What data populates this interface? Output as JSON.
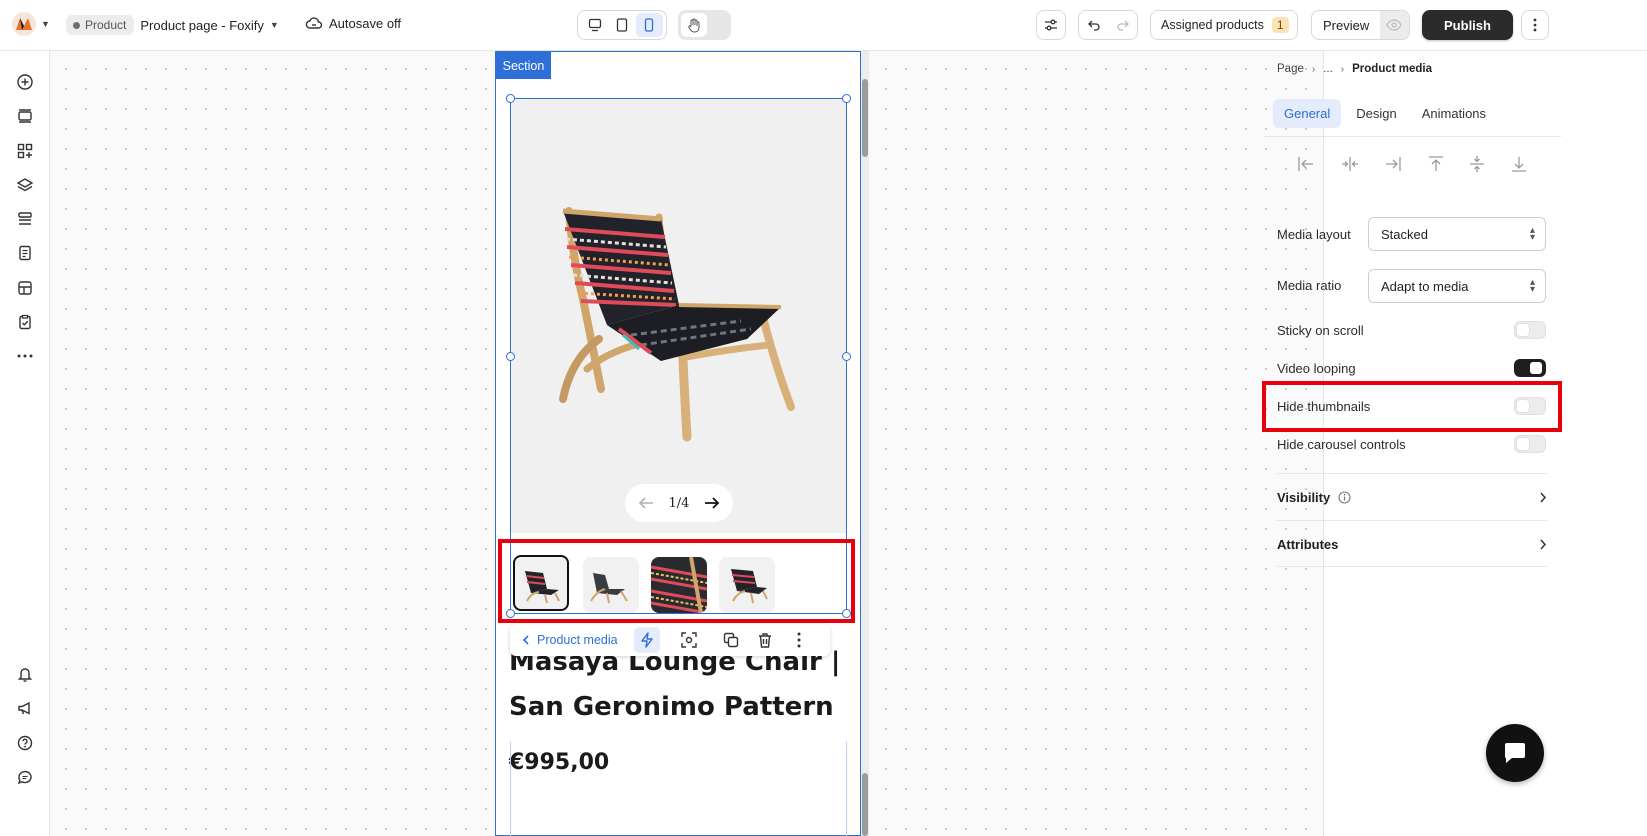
{
  "topbar": {
    "breadcrumb_badge": "Product",
    "page_name": "Product page - Foxify",
    "autosave": "Autosave off",
    "assigned_products": "Assigned products",
    "assigned_count": "1",
    "preview": "Preview",
    "publish": "Publish"
  },
  "leftbar": {
    "icons": [
      "add-icon",
      "section-icon",
      "apps-icon",
      "layers-icon",
      "sections-list-icon",
      "pages-icon",
      "templates-icon",
      "checklist-icon",
      "more-icon",
      "bell-icon",
      "megaphone-icon",
      "help-icon",
      "chat-icon"
    ]
  },
  "canvas": {
    "section_label": "Section",
    "pager": "1/4",
    "toolbar_label": "Product media",
    "product_title_line1": "Masaya Lounge Chair |",
    "product_title_line2": "San Geronimo Pattern",
    "price": "€995,00"
  },
  "panel": {
    "crumb_root": "Page",
    "crumb_mid": "...",
    "crumb_current": "Product media",
    "tabs": [
      "General",
      "Design",
      "Animations"
    ],
    "active_tab": "General",
    "media_layout_label": "Media layout",
    "media_layout_value": "Stacked",
    "media_ratio_label": "Media ratio",
    "media_ratio_value": "Adapt to media",
    "sticky_label": "Sticky on scroll",
    "sticky_on": false,
    "video_looping_label": "Video looping",
    "video_looping_on": true,
    "hide_thumbnails_label": "Hide thumbnails",
    "hide_thumbnails_on": false,
    "hide_carousel_label": "Hide carousel controls",
    "hide_carousel_on": false,
    "visibility": "Visibility",
    "attributes": "Attributes"
  },
  "colors": {
    "accent": "#2d6fd6",
    "highlight": "#e8000b",
    "publish_bg": "#2b2b2b",
    "tab_active_bg": "#e4ecfb",
    "badge_orange": "#fde2b6"
  }
}
